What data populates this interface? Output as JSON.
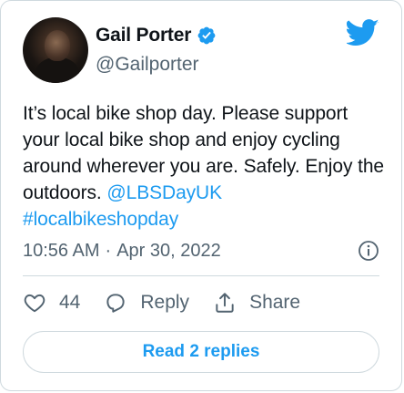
{
  "author": {
    "name": "Gail Porter",
    "handle": "@Gailporter"
  },
  "tweet": {
    "text_main": "It’s local bike shop day. Please support your local bike shop and enjoy cycling around wherever you are. Safely. Enjoy the outdoors. ",
    "mention": "@LBSDayUK",
    "hashtag": "#localbikeshopday"
  },
  "meta": {
    "time": "10:56 AM",
    "separator": "·",
    "date": "Apr 30, 2022"
  },
  "actions": {
    "like_count": "44",
    "reply_label": "Reply",
    "share_label": "Share"
  },
  "replies_button": "Read 2 replies",
  "colors": {
    "accent": "#1d9bf0",
    "muted": "#536471",
    "border": "#cfd9de",
    "text": "#0f1419"
  },
  "icons": [
    "verified-badge-icon",
    "twitter-bird-icon",
    "info-icon",
    "heart-icon",
    "reply-icon",
    "share-icon"
  ]
}
